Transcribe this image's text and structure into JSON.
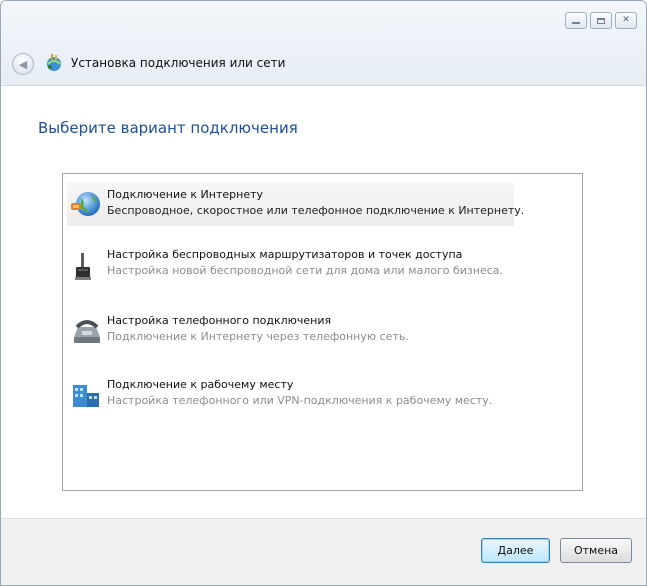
{
  "window": {
    "title": "Установка подключения или сети",
    "heading": "Выберите вариант подключения"
  },
  "options": [
    {
      "title": "Подключение к Интернету",
      "description": "Беспроводное, скоростное или телефонное подключение к Интернету.",
      "icon": "globe-network-icon",
      "selected": true
    },
    {
      "title": "Настройка беспроводных маршрутизаторов и точек доступа",
      "description": "Настройка новой беспроводной сети для дома или малого бизнеса.",
      "icon": "wireless-router-icon",
      "selected": false
    },
    {
      "title": "Настройка телефонного подключения",
      "description": "Подключение к Интернету через телефонную сеть.",
      "icon": "telephone-modem-icon",
      "selected": false
    },
    {
      "title": "Подключение к рабочему месту",
      "description": "Настройка телефонного или VPN-подключения к рабочему месту.",
      "icon": "workplace-building-icon",
      "selected": false
    }
  ],
  "buttons": {
    "next": "Далее",
    "cancel": "Отмена"
  },
  "colors": {
    "heading": "#1e4f9a",
    "footer": "#f0f0f0",
    "default_button_border": "#3c7fb1"
  }
}
